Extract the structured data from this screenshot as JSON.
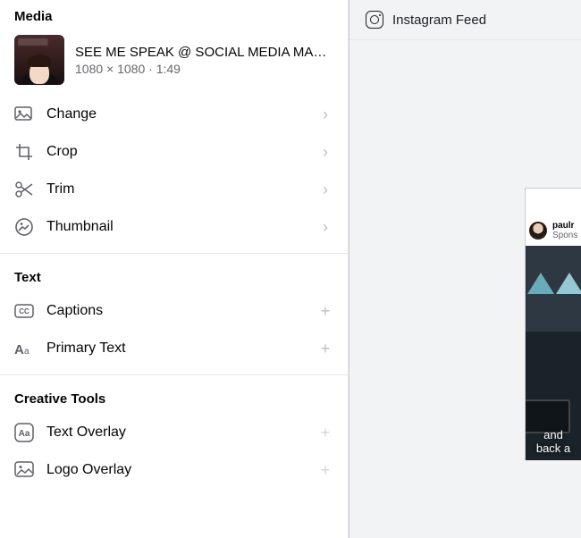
{
  "sections": {
    "media": "Media",
    "text": "Text",
    "creativeTools": "Creative Tools"
  },
  "media": {
    "title": "SEE ME SPEAK @ SOCIAL MEDIA MAR…",
    "dimensions": "1080 × 1080",
    "duration": "1:49"
  },
  "mediaActions": {
    "change": "Change",
    "crop": "Crop",
    "trim": "Trim",
    "thumbnail": "Thumbnail"
  },
  "textActions": {
    "captions": "Captions",
    "primaryText": "Primary Text"
  },
  "creativeActions": {
    "textOverlay": "Text Overlay",
    "logoOverlay": "Logo Overlay"
  },
  "preview": {
    "title": "Instagram Feed",
    "post": {
      "username": "paulr",
      "sponsored": "Spons",
      "captionLine1": "and",
      "captionLine2": "back a"
    }
  }
}
